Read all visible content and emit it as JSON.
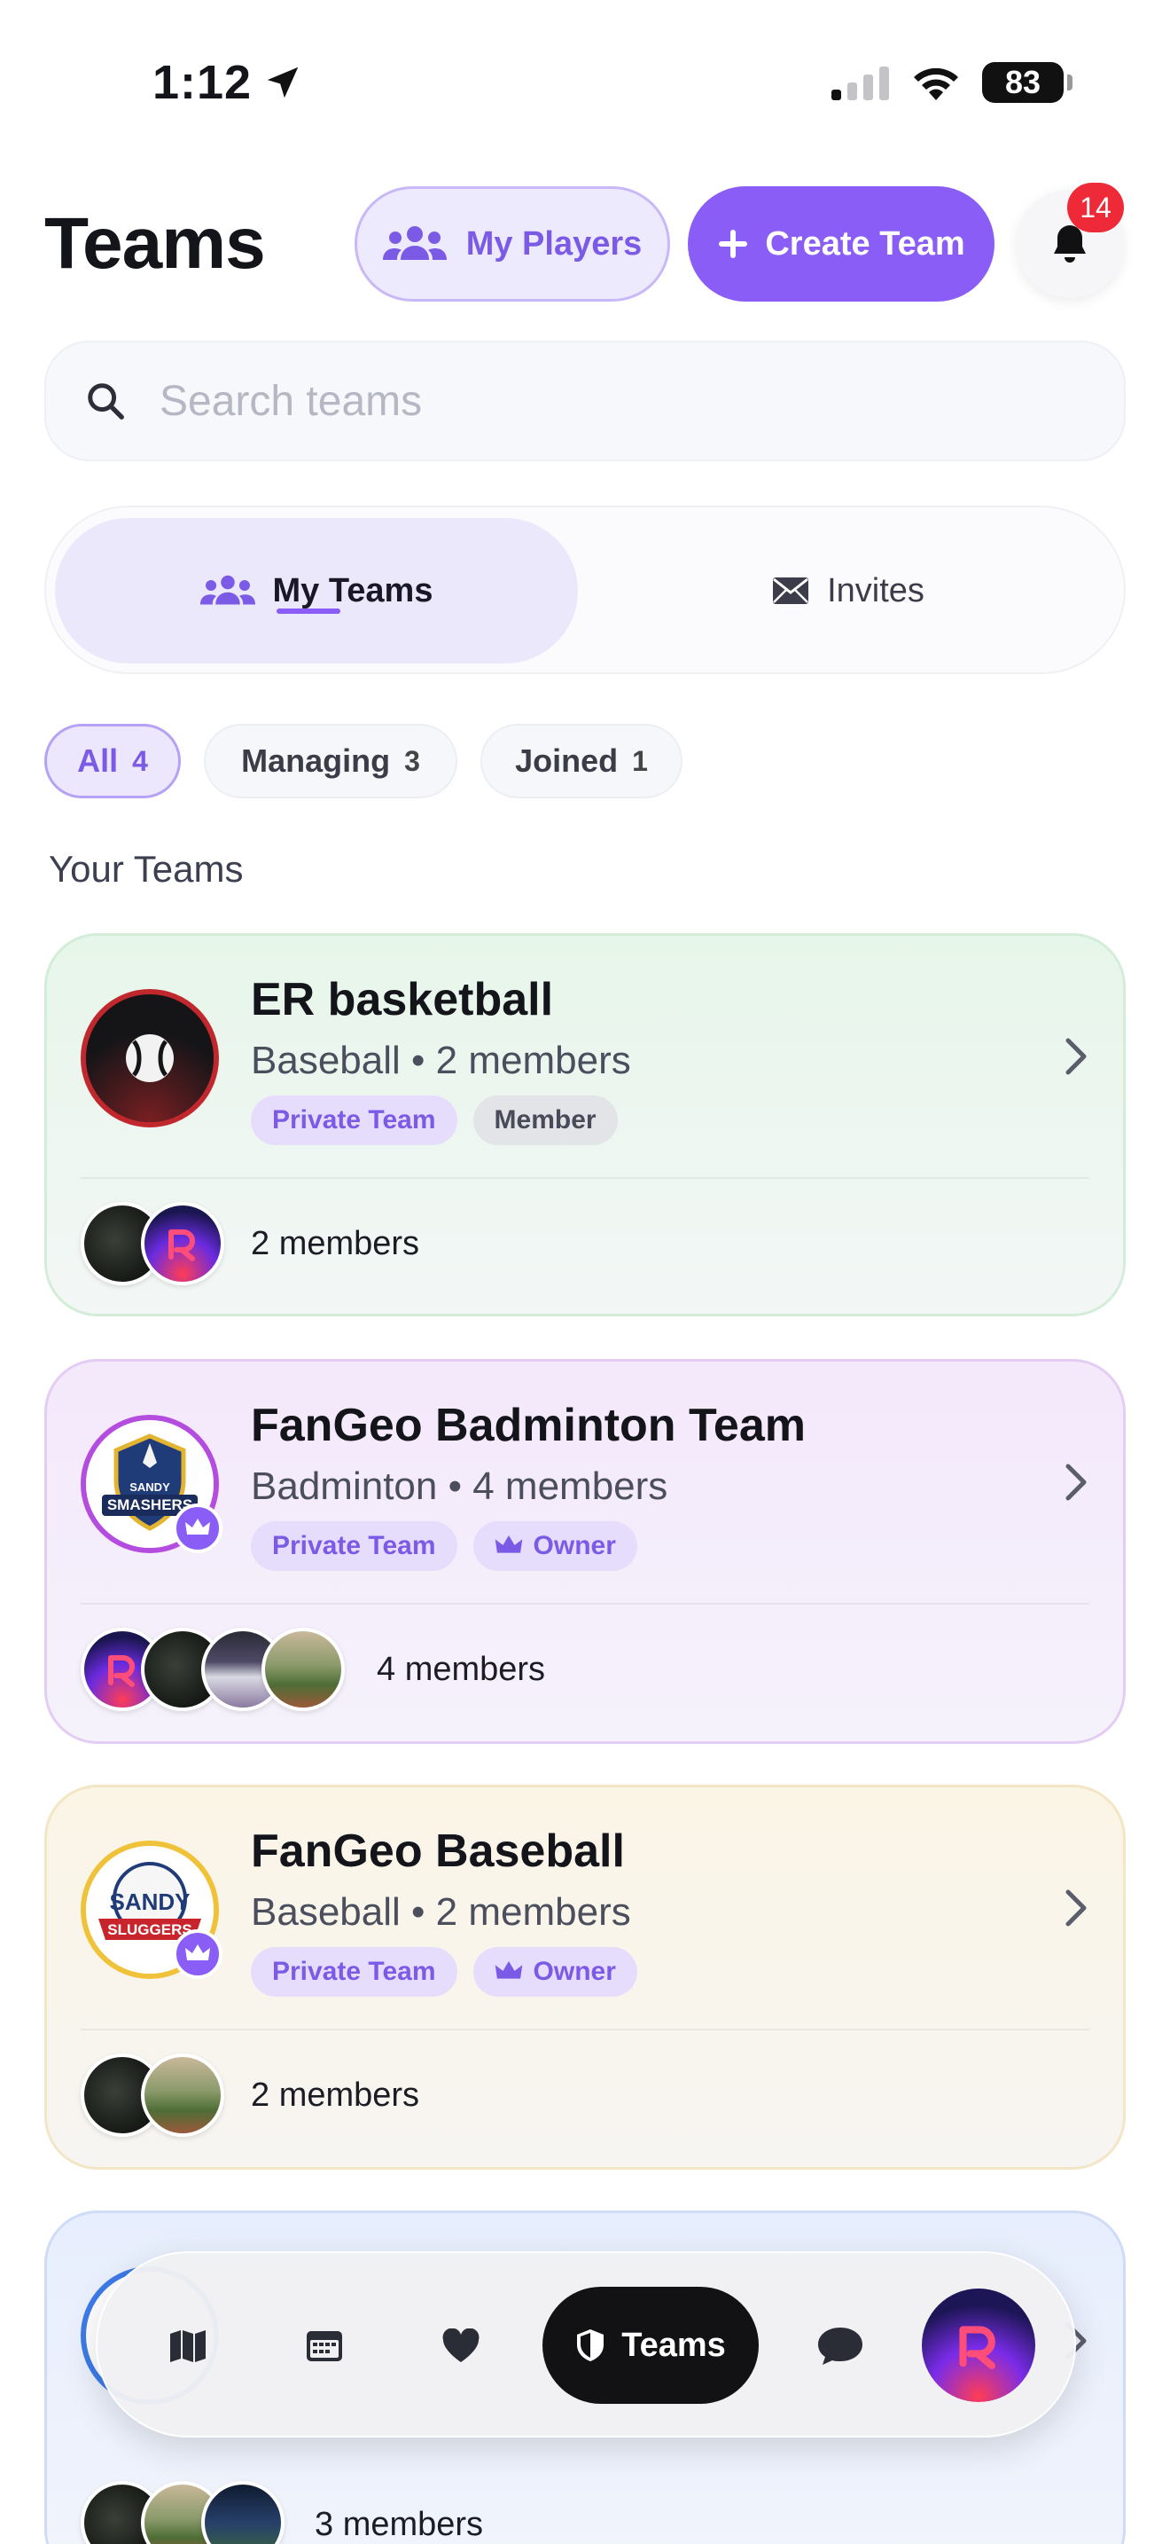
{
  "status_bar": {
    "time": "1:12",
    "battery": "83"
  },
  "header": {
    "title": "Teams",
    "my_players_label": "My Players",
    "create_team_label": "Create Team",
    "notification_count": "14"
  },
  "search": {
    "placeholder": "Search teams"
  },
  "segments": {
    "my_teams": "My Teams",
    "invites": "Invites"
  },
  "filters": [
    {
      "label": "All",
      "count": "4",
      "active": true
    },
    {
      "label": "Managing",
      "count": "3",
      "active": false
    },
    {
      "label": "Joined",
      "count": "1",
      "active": false
    }
  ],
  "section_title": "Your Teams",
  "teams": [
    {
      "name": "ER basketball",
      "sport": "Baseball",
      "members": "2 members",
      "privacy": "Private Team",
      "role": "Member",
      "members_footer": "2 members"
    },
    {
      "name": "FanGeo Badminton Team",
      "sport": "Badminton",
      "members": "4 members",
      "privacy": "Private Team",
      "role": "Owner",
      "members_footer": "4 members",
      "logo_text": [
        "SANDY",
        "SMASHERS"
      ]
    },
    {
      "name": "FanGeo Baseball",
      "sport": "Baseball",
      "members": "2 members",
      "privacy": "Private Team",
      "role": "Owner",
      "members_footer": "2 members",
      "logo_text": [
        "SANDY",
        "SLUGGERS"
      ]
    },
    {
      "members_footer": "3 members"
    }
  ],
  "separator": "•",
  "tabbar": {
    "active_label": "Teams"
  },
  "colors": {
    "accent": "#8a5df6",
    "badge_red": "#ee2a39",
    "active_nav": "#121214"
  }
}
